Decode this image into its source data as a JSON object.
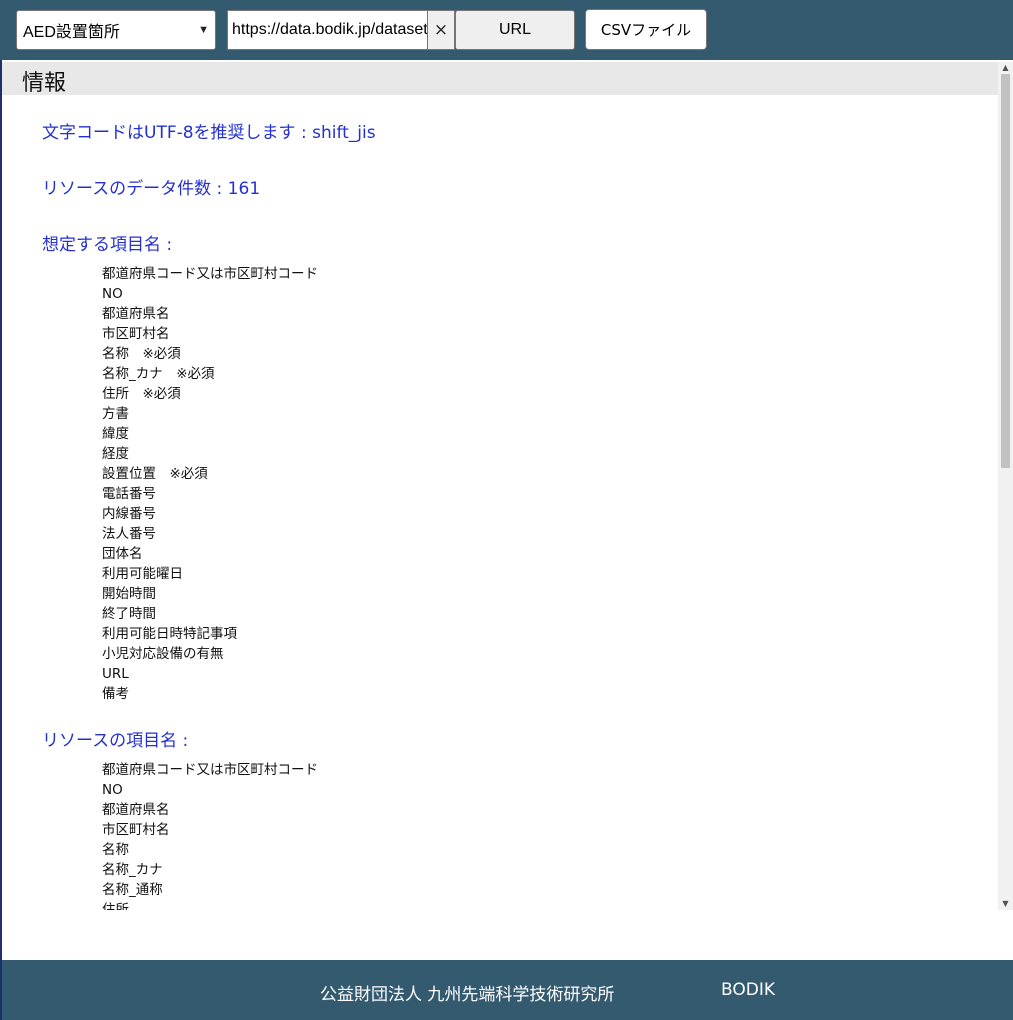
{
  "toolbar": {
    "dataset_select_value": "AED設置箇所",
    "url_value": "https://data.bodik.jp/dataset",
    "clear_label": "×",
    "url_button_label": "URL",
    "csv_button_label": "CSVファイル"
  },
  "info": {
    "title": "情報",
    "encoding_line": "文字コードはUTF-8を推奨します : shift_jis",
    "count_line": "リソースのデータ件数 : 161",
    "expected_heading": "想定する項目名 :",
    "expected_fields": [
      "都道府県コード又は市区町村コード",
      "NO",
      "都道府県名",
      "市区町村名",
      "名称　※必須",
      "名称_カナ　※必須",
      "住所　※必須",
      "方書",
      "緯度",
      "経度",
      "設置位置　※必須",
      "電話番号",
      "内線番号",
      "法人番号",
      "団体名",
      "利用可能曜日",
      "開始時間",
      "終了時間",
      "利用可能日時特記事項",
      "小児対応設備の有無",
      "URL",
      "備考"
    ],
    "resource_heading": "リソースの項目名 :",
    "resource_fields": [
      "都道府県コード又は市区町村コード",
      "NO",
      "都道府県名",
      "市区町村名",
      "名称",
      "名称_カナ",
      "名称_通称",
      "住所"
    ]
  },
  "footer": {
    "org": "公益財団法人 九州先端科学技術研究所",
    "bodik": "BODIK"
  },
  "colors": {
    "header_bg": "#345a70",
    "link_blue": "#2430d0"
  }
}
